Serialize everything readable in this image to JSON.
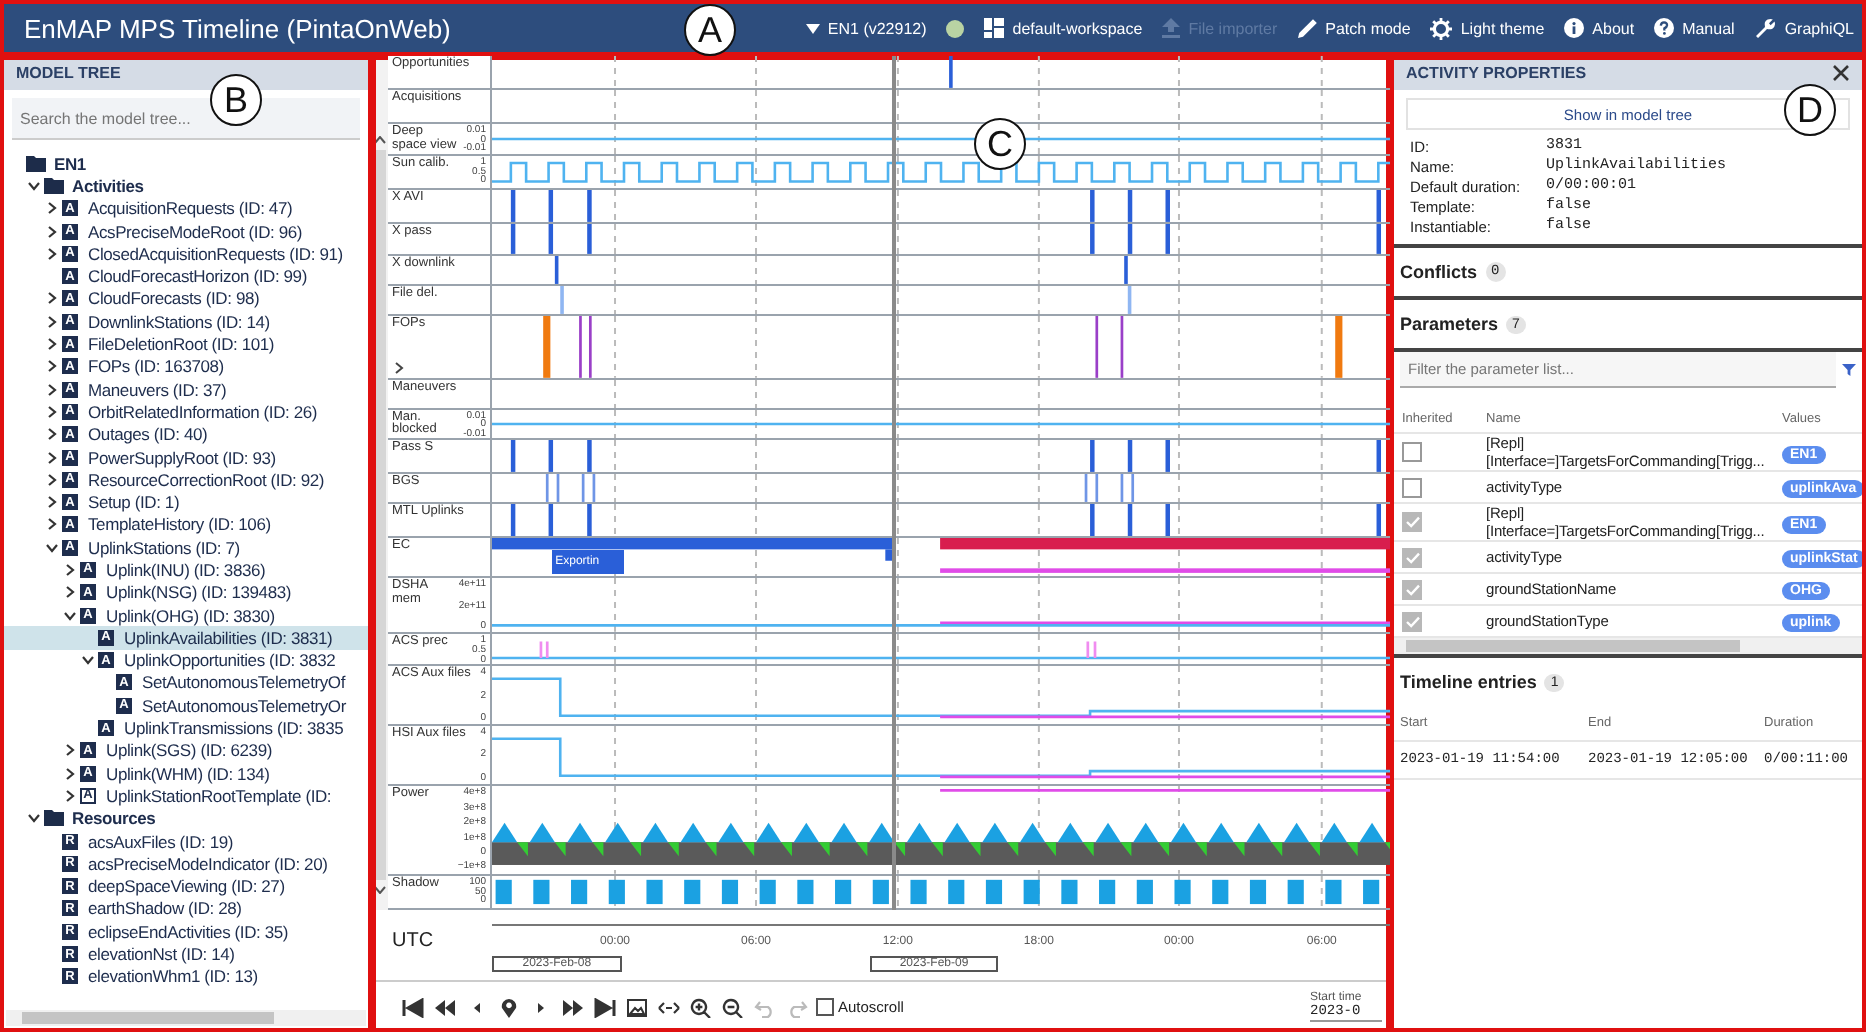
{
  "header": {
    "title": "EnMAP MPS Timeline (PintaOnWeb)",
    "mission": "EN1 (v22912)",
    "workspace": "default-workspace",
    "actions": [
      {
        "kind": "upload",
        "label": "File importer",
        "disabled": true
      },
      {
        "kind": "pencil",
        "label": "Patch mode",
        "disabled": false
      },
      {
        "kind": "theme",
        "label": "Light theme",
        "disabled": false
      },
      {
        "kind": "info",
        "label": "About",
        "disabled": false
      },
      {
        "kind": "help",
        "label": "Manual",
        "disabled": false
      },
      {
        "kind": "wrench",
        "label": "GraphiQL",
        "disabled": false
      }
    ]
  },
  "tree": {
    "title": "MODEL TREE",
    "placeholder": "Search the model tree...",
    "nodes": [
      {
        "label": "EN1",
        "kind": "folder",
        "selected": false,
        "children": [
          {
            "label": "Activities",
            "kind": "folder",
            "expanded": true,
            "selected": false,
            "children": [
              {
                "label": "AcquisitionRequests (ID: 47)",
                "badge": "A",
                "expanded": false,
                "selected": false
              },
              {
                "label": "AcsPreciseModeRoot (ID: 96)",
                "badge": "A",
                "expanded": false,
                "selected": false
              },
              {
                "label": "ClosedAcquisitionRequests (ID: 91)",
                "badge": "A",
                "expanded": false,
                "selected": false
              },
              {
                "label": "CloudForecastHorizon (ID: 99)",
                "badge": "A",
                "selected": false
              },
              {
                "label": "CloudForecasts (ID: 98)",
                "badge": "A",
                "expanded": false,
                "selected": false
              },
              {
                "label": "DownlinkStations (ID: 14)",
                "badge": "A",
                "expanded": false,
                "selected": false
              },
              {
                "label": "FileDeletionRoot (ID: 101)",
                "badge": "A",
                "expanded": false,
                "selected": false
              },
              {
                "label": "FOPs (ID: 163708)",
                "badge": "A",
                "expanded": false,
                "selected": false
              },
              {
                "label": "Maneuvers (ID: 37)",
                "badge": "A",
                "expanded": false,
                "selected": false
              },
              {
                "label": "OrbitRelatedInformation (ID: 26)",
                "badge": "A",
                "expanded": false,
                "selected": false
              },
              {
                "label": "Outages (ID: 40)",
                "badge": "A",
                "expanded": false,
                "selected": false
              },
              {
                "label": "PowerSupplyRoot (ID: 93)",
                "badge": "A",
                "expanded": false,
                "selected": false
              },
              {
                "label": "ResourceCorrectionRoot (ID: 92)",
                "badge": "A",
                "expanded": false,
                "selected": false
              },
              {
                "label": "Setup (ID: 1)",
                "badge": "A",
                "expanded": false,
                "selected": false
              },
              {
                "label": "TemplateHistory (ID: 106)",
                "badge": "A",
                "expanded": false,
                "selected": false
              },
              {
                "label": "UplinkStations (ID: 7)",
                "badge": "A",
                "expanded": true,
                "selected": false,
                "children": [
                  {
                    "label": "Uplink(INU) (ID: 3836)",
                    "badge": "A",
                    "expanded": false,
                    "selected": false
                  },
                  {
                    "label": "Uplink(NSG) (ID: 139483)",
                    "badge": "A",
                    "expanded": false,
                    "selected": false
                  },
                  {
                    "label": "Uplink(OHG) (ID: 3830)",
                    "badge": "A",
                    "expanded": true,
                    "selected": false,
                    "children": [
                      {
                        "label": "UplinkAvailabilities (ID: 3831)",
                        "badge": "A",
                        "selected": true
                      },
                      {
                        "label": "UplinkOpportunities (ID: 3832",
                        "badge": "A",
                        "expanded": true,
                        "selected": false,
                        "children": [
                          {
                            "label": "SetAutonomousTelemetryOf",
                            "badge": "A",
                            "selected": false
                          },
                          {
                            "label": "SetAutonomousTelemetryOr",
                            "badge": "A",
                            "selected": false
                          }
                        ]
                      },
                      {
                        "label": "UplinkTransmissions (ID: 3835",
                        "badge": "A",
                        "selected": false
                      }
                    ]
                  },
                  {
                    "label": "Uplink(SGS) (ID: 6239)",
                    "badge": "A",
                    "expanded": false,
                    "selected": false
                  },
                  {
                    "label": "Uplink(WHM) (ID: 134)",
                    "badge": "A",
                    "expanded": false,
                    "selected": false
                  },
                  {
                    "label": "UplinkStationRootTemplate (ID:",
                    "kind": "template",
                    "badge": "A",
                    "expanded": false,
                    "selected": false
                  }
                ]
              }
            ]
          },
          {
            "label": "Resources",
            "kind": "folder",
            "expanded": true,
            "selected": false,
            "children": [
              {
                "label": "acsAuxFiles (ID: 19)",
                "badge": "R",
                "selected": false
              },
              {
                "label": "acsPreciseModeIndicator (ID: 20)",
                "badge": "R",
                "selected": false
              },
              {
                "label": "deepSpaceViewing (ID: 27)",
                "badge": "R",
                "selected": false
              },
              {
                "label": "earthShadow (ID: 28)",
                "badge": "R",
                "selected": false
              },
              {
                "label": "eclipseEndActivities (ID: 35)",
                "badge": "R",
                "selected": false
              },
              {
                "label": "elevationNst (ID: 14)",
                "badge": "R",
                "selected": false
              },
              {
                "label": "elevationWhm1 (ID: 13)",
                "badge": "R",
                "selected": false
              }
            ]
          }
        ]
      }
    ]
  },
  "tracks": [
    {
      "label": "Opportunities",
      "kind": "marker"
    },
    {
      "label": "Acquisitions",
      "kind": "blank"
    },
    {
      "label": "Deep space view",
      "kind": "flat",
      "ticks": [
        "0.01",
        "0",
        "-0.01"
      ]
    },
    {
      "label": "Sun calib.",
      "kind": "square",
      "ticks": [
        "1",
        "0.5",
        "0"
      ]
    },
    {
      "label": "X AVI",
      "kind": "spikes"
    },
    {
      "label": "X pass",
      "kind": "spikes"
    },
    {
      "label": "X downlink",
      "kind": "single"
    },
    {
      "label": "File del.",
      "kind": "thin"
    },
    {
      "label": "FOPs",
      "kind": "fops",
      "expanded": false
    },
    {
      "label": "Maneuvers",
      "kind": "blank"
    },
    {
      "label": "Man. blocked",
      "kind": "flat",
      "ticks": [
        "0.01",
        "0",
        "-0.01"
      ]
    },
    {
      "label": "Pass S",
      "kind": "spikes"
    },
    {
      "label": "BGS",
      "kind": "pairs"
    },
    {
      "label": "MTL Uplinks",
      "kind": "spikes"
    },
    {
      "label": "EC",
      "kind": "ec",
      "block_label": "Exportin"
    },
    {
      "label": "DSHA mem",
      "kind": "memory",
      "ticks": [
        "4e+11",
        "2e+11",
        "0"
      ]
    },
    {
      "label": "ACS prec",
      "kind": "precision",
      "ticks": [
        "1",
        "0.5",
        "0"
      ]
    },
    {
      "label": "ACS Aux files",
      "kind": "drop",
      "ticks": [
        "4",
        "2",
        "0"
      ]
    },
    {
      "label": "HSI Aux files",
      "kind": "drop",
      "ticks": [
        "4",
        "2",
        "0"
      ]
    },
    {
      "label": "Power",
      "kind": "power",
      "ticks": [
        "4e+8",
        "3e+8",
        "2e+8",
        "1e+8",
        "0",
        "−1e+8"
      ]
    },
    {
      "label": "Shadow",
      "kind": "shadow",
      "ticks": [
        "100",
        "50",
        "0"
      ]
    }
  ],
  "axis": {
    "label": "UTC",
    "ticks": [
      "00:00",
      "06:00",
      "12:00",
      "18:00",
      "00:00",
      "06:00"
    ],
    "dates": [
      "2023-Feb-08",
      "2023-Feb-09"
    ]
  },
  "controls": [
    {
      "kind": "first",
      "disabled": false
    },
    {
      "kind": "rewind",
      "disabled": false
    },
    {
      "kind": "back",
      "disabled": false
    },
    {
      "kind": "pin",
      "disabled": false
    },
    {
      "kind": "forward",
      "disabled": false
    },
    {
      "kind": "fastforward",
      "disabled": false
    },
    {
      "kind": "last",
      "disabled": false
    },
    {
      "kind": "image",
      "disabled": false
    },
    {
      "kind": "fit",
      "disabled": false
    },
    {
      "kind": "zoomin",
      "disabled": false
    },
    {
      "kind": "zoomout",
      "disabled": false
    },
    {
      "kind": "undo",
      "disabled": true
    },
    {
      "kind": "redo",
      "disabled": true
    }
  ],
  "autoscroll": {
    "label": "Autoscroll",
    "checked": false
  },
  "start_time": {
    "label": "Start time",
    "value": "2023-0"
  },
  "properties": {
    "title": "ACTIVITY PROPERTIES",
    "show_button": "Show in model tree",
    "fields": [
      {
        "label": "ID:",
        "value": "3831"
      },
      {
        "label": "Name:",
        "value": "UplinkAvailabilities"
      },
      {
        "label": "Default duration:",
        "value": "0/00:00:01"
      },
      {
        "label": "Template:",
        "value": "false"
      },
      {
        "label": "Instantiable:",
        "value": "false"
      }
    ],
    "conflicts": {
      "title": "Conflicts",
      "count": "0"
    },
    "parameters": {
      "title": "Parameters",
      "count": "7",
      "placeholder": "Filter the parameter list...",
      "columns": [
        "Inherited",
        "Name",
        "Values"
      ],
      "rows": [
        {
          "inherited": false,
          "name_lines": [
            "[Repl]",
            "[Interface=]TargetsForCommanding[Trigg..."
          ],
          "value": "EN1"
        },
        {
          "inherited": false,
          "name_lines": [
            "activityType"
          ],
          "value": "uplinkAva"
        },
        {
          "inherited": true,
          "name_lines": [
            "[Repl]",
            "[Interface=]TargetsForCommanding[Trigg..."
          ],
          "value": "EN1"
        },
        {
          "inherited": true,
          "name_lines": [
            "activityType"
          ],
          "value": "uplinkStat"
        },
        {
          "inherited": true,
          "name_lines": [
            "groundStationName"
          ],
          "value": "OHG"
        },
        {
          "inherited": true,
          "name_lines": [
            "groundStationType"
          ],
          "value": "uplink"
        }
      ]
    },
    "entries": {
      "title": "Timeline entries",
      "count": "1",
      "columns": [
        "Start",
        "End",
        "Duration"
      ],
      "rows": [
        [
          "2023-01-19 11:54:00",
          "2023-01-19 12:05:00",
          "0/00:11:00"
        ]
      ]
    }
  },
  "callouts": [
    "A",
    "B",
    "C",
    "D"
  ]
}
